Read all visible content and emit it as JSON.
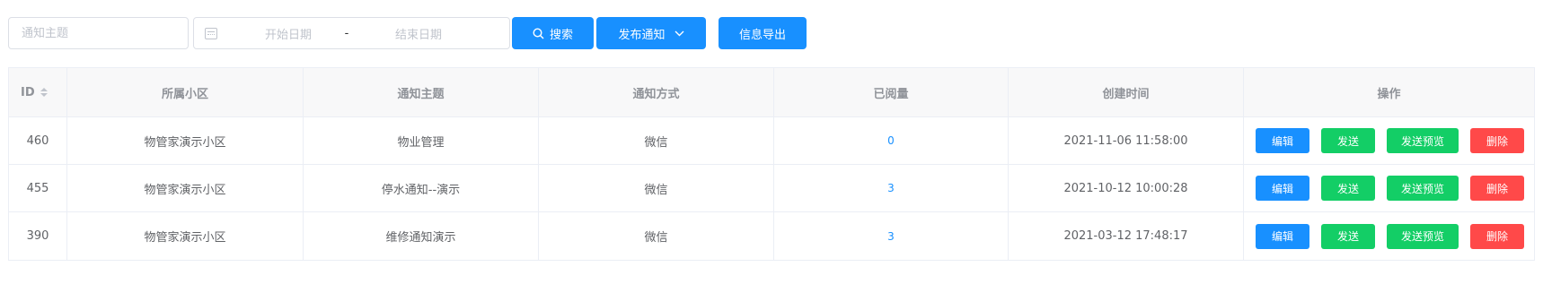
{
  "filters": {
    "subject_placeholder": "通知主题",
    "date_start_placeholder": "开始日期",
    "date_separator": "-",
    "date_end_placeholder": "结束日期"
  },
  "toolbar": {
    "search_label": "搜索",
    "publish_label": "发布通知",
    "export_label": "信息导出"
  },
  "table": {
    "headers": {
      "id": "ID",
      "community": "所属小区",
      "subject": "通知主题",
      "method": "通知方式",
      "read_count": "已阅量",
      "created_at": "创建时间",
      "actions": "操作"
    },
    "rows": [
      {
        "id": "460",
        "community": "物管家演示小区",
        "subject": "物业管理",
        "method": "微信",
        "read_count": "0",
        "created_at": "2021-11-06 11:58:00"
      },
      {
        "id": "455",
        "community": "物管家演示小区",
        "subject": "停水通知--演示",
        "method": "微信",
        "read_count": "3",
        "created_at": "2021-10-12 10:00:28"
      },
      {
        "id": "390",
        "community": "物管家演示小区",
        "subject": "维修通知演示",
        "method": "微信",
        "read_count": "3",
        "created_at": "2021-03-12 17:48:17"
      }
    ],
    "actions": {
      "edit": "编辑",
      "send": "发送",
      "preview": "发送预览",
      "delete": "删除"
    }
  },
  "colors": {
    "primary": "#1890ff",
    "success": "#13ce66",
    "danger": "#ff4949"
  }
}
